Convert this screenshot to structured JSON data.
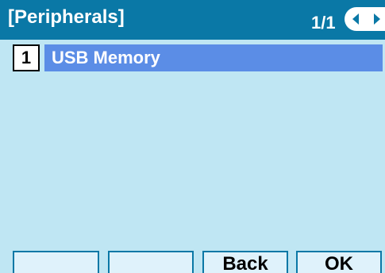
{
  "title_bar": {
    "title": "[Peripherals]",
    "page_indicator": "1/1",
    "nav_left_icon": "left-arrow-icon",
    "nav_right_icon": "right-arrow-icon"
  },
  "menu": {
    "items": [
      {
        "number": "1",
        "label": "USB Memory"
      }
    ]
  },
  "softkeys": [
    {
      "label": ""
    },
    {
      "label": ""
    },
    {
      "label": "Back"
    },
    {
      "label": "OK"
    }
  ],
  "colors": {
    "title_bar": "#0a78a6",
    "background": "#bfe6f3",
    "selected_item": "#5b8de6",
    "softkey_fill": "#dff2fb"
  }
}
